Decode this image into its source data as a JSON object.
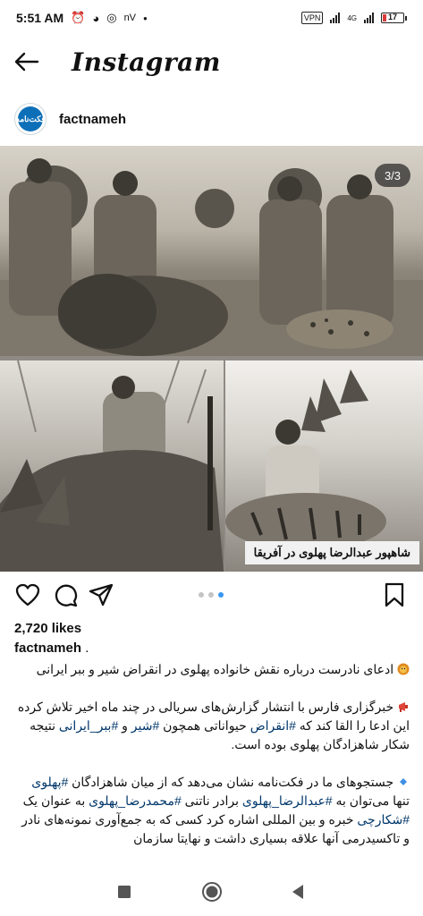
{
  "status_bar": {
    "time": "5:51 AM",
    "extra": "nV",
    "vpn": "VPN",
    "network": "4G",
    "battery": "17",
    "battery_fraction": 0.17
  },
  "header": {
    "title": "Instagram"
  },
  "post": {
    "avatar_text": "فکت‌نامه",
    "username": "factnameh",
    "image_counter": "3/3",
    "image_caption": "شاهپور عبدالرضا پهلوی در آفریقا",
    "carousel": {
      "count": 3,
      "active_index": 2
    },
    "likes": "2,720 likes",
    "author": "factnameh",
    "author_suffix": " .",
    "caption": {
      "line1": "ادعای نادرست درباره نقش خانواده پهلوی در انقراض شیر و ببر ایرانی",
      "p2_a": "خبرگزاری فارس با انتشار گزارش‌های سریالی در چند ماه اخیر تلاش کرده این ادعا را القا کند که ",
      "p2_tag1": "#انقراض",
      "p2_b": " حیواناتی همچون ",
      "p2_tag2": "#شیر",
      "p2_c": " و ",
      "p2_tag3": "#ببر_ایرانی",
      "p2_d": " نتیجه شکار شاهزادگان پهلوی بوده است.",
      "p3_a": "جستجوهای ما در فکت‌نامه نشان می‌دهد که از میان شاهزادگان ",
      "p3_tag1": "#پهلوی",
      "p3_b": " تنها می‌توان به ",
      "p3_tag2": "#عبدالرضا_پهلوی",
      "p3_c": " برادر ناتنی ",
      "p3_tag3": "#محمدرضا_پهلوی",
      "p3_d": " به عنوان یک ",
      "p3_tag4": "#شکارچی",
      "p3_e": " خبره و بین المللی اشاره کرد کسی که به جمع‌آوری نمونه‌های نادر و تاکسیدرمی آنها علاقه بسیاری داشت و نهایتا سازمان"
    }
  },
  "icons": {
    "back": "arrow-left-icon",
    "like": "heart-icon",
    "comment": "comment-icon",
    "share": "send-icon",
    "save": "bookmark-icon",
    "nav_recent": "square-icon",
    "nav_home": "circle-icon",
    "nav_back": "triangle-back-icon"
  },
  "colors": {
    "link": "#00376b",
    "carousel_active": "#3897f0",
    "battery_low": "#d93a3a"
  }
}
